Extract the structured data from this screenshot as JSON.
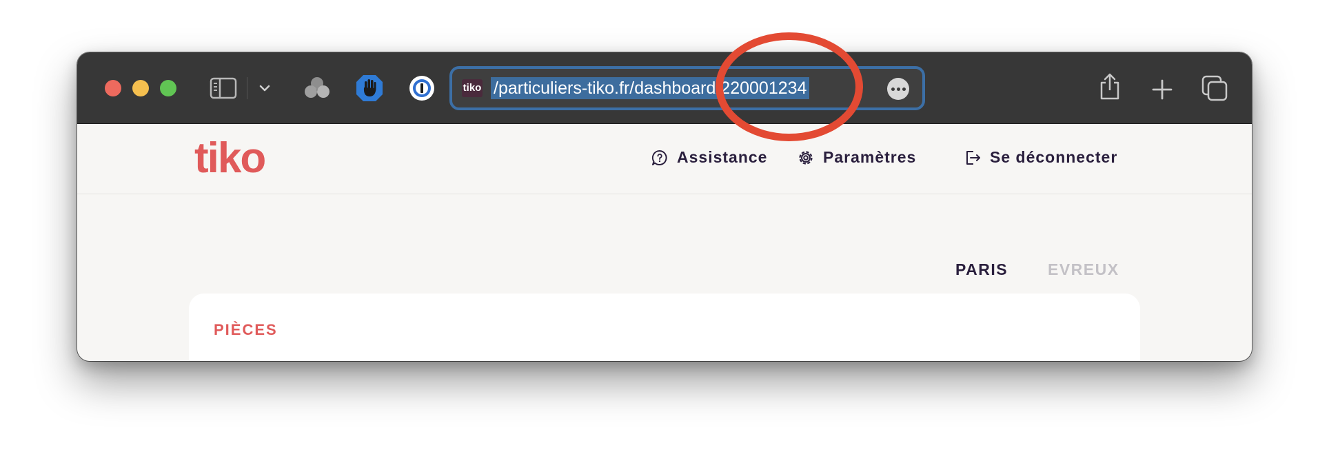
{
  "browser": {
    "url": "/particuliers-tiko.fr/dashboard/220001234",
    "favicon_text": "tiko",
    "icons": {
      "sidebar": "sidebar-icon",
      "chevron": "chevron-down-icon",
      "ext1": "clover-icon",
      "ext2": "hand-icon",
      "ext3": "password-manager-icon",
      "more": "ellipsis-icon",
      "share": "share-icon",
      "new_tab": "plus-icon",
      "tabs": "tabs-overview-icon"
    }
  },
  "site": {
    "logo": "tiko",
    "nav": {
      "assistance": "Assistance",
      "parametres": "Paramètres",
      "logout": "Se déconnecter"
    },
    "tabs": [
      "PARIS",
      "EVREUX"
    ],
    "card_title": "PIÈCES"
  },
  "colors": {
    "brand": "#e05a5a",
    "text_dark": "#2a1f3d",
    "annotation": "#e34a33",
    "room_strips": [
      "#2a7fa0",
      "#2a9a8c",
      "#d8554f",
      "#f0a45a"
    ]
  }
}
